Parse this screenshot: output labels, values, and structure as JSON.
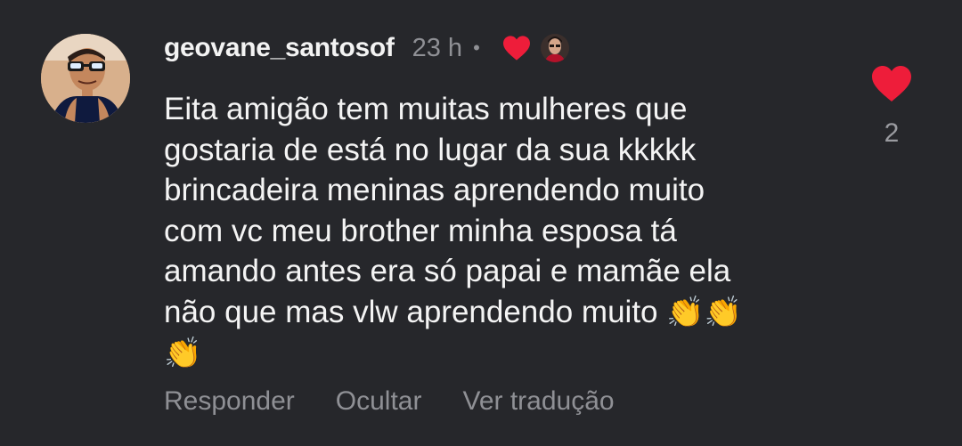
{
  "comment": {
    "username": "geovane_santosof",
    "time": "23 h",
    "separator": "•",
    "text_lines": [
      "Eita amigão tem muitas mulheres que",
      "gostaria de está no lugar da sua kkkkk",
      "brincadeira meninas aprendendo muito",
      "com vc meu brother minha esposa tá",
      "amando antes era só papai e mamãe ela",
      "não que mas vlw aprendendo muito"
    ],
    "emojis": [
      "👏",
      "👏",
      "👏"
    ],
    "author_liked_icon": "heart-icon",
    "like_count": "2"
  },
  "actions": {
    "reply": "Responder",
    "hide": "Ocultar",
    "translate": "Ver tradução"
  },
  "colors": {
    "background": "#26272b",
    "heart": "#ee1d3a",
    "muted_text": "#8f9095"
  }
}
